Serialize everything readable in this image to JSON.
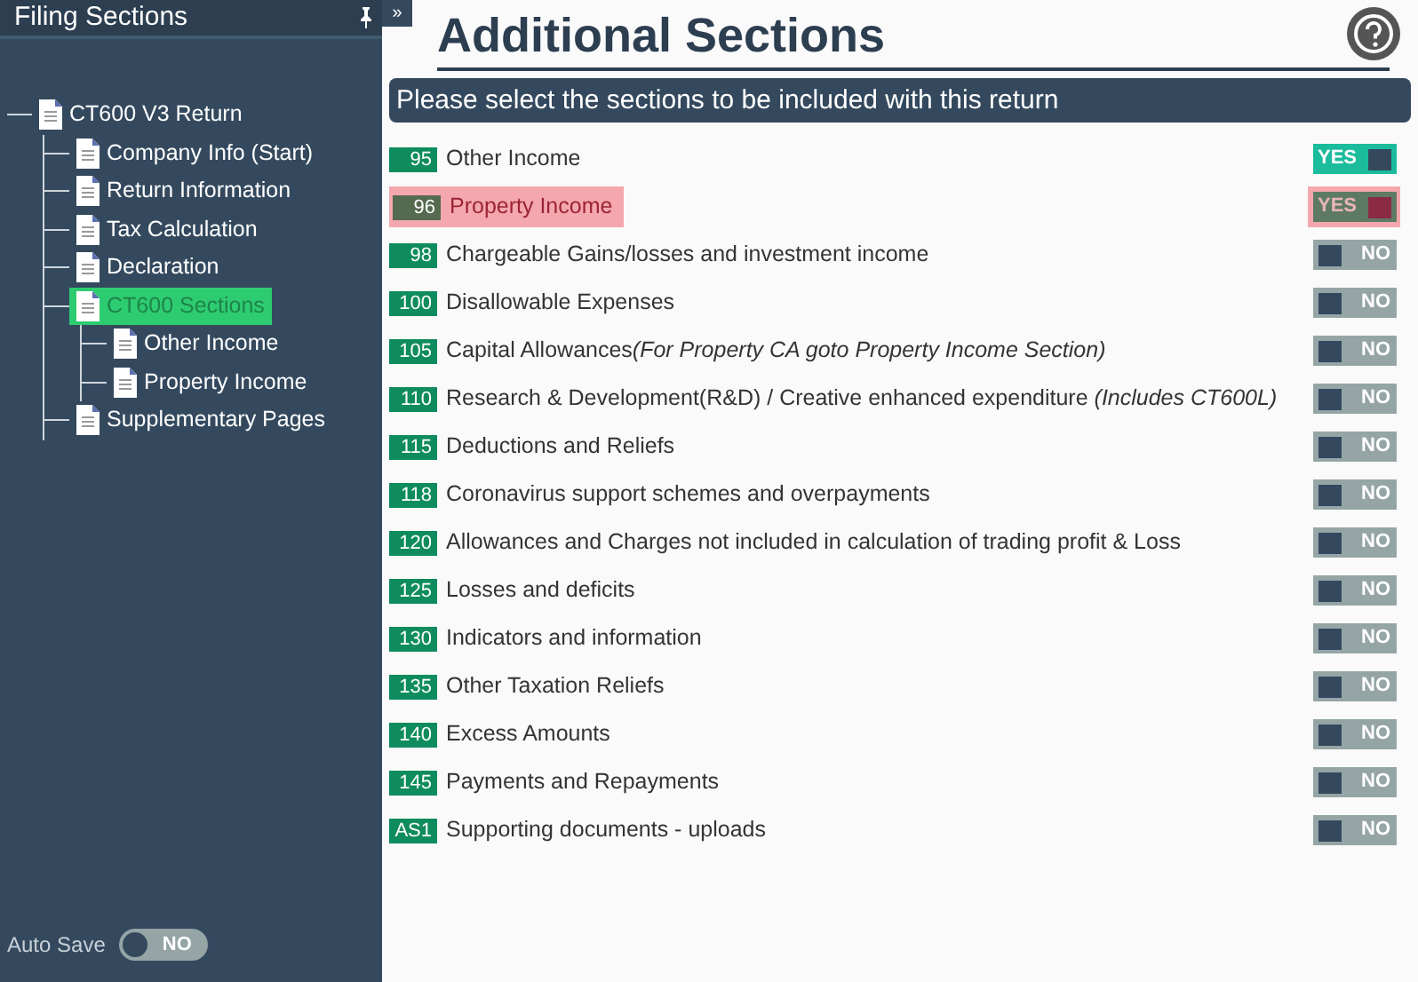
{
  "sidebar": {
    "title": "Filing Sections",
    "collapse_button": "»",
    "tree": [
      {
        "label": "CT600 V3 Return",
        "selected": false,
        "children": [
          {
            "label": "Company Info (Start)",
            "selected": false
          },
          {
            "label": "Return Information",
            "selected": false
          },
          {
            "label": "Tax Calculation",
            "selected": false
          },
          {
            "label": "Declaration",
            "selected": false
          },
          {
            "label": "CT600 Sections",
            "selected": true,
            "children": [
              {
                "label": "Other Income",
                "selected": false
              },
              {
                "label": "Property Income",
                "selected": false
              }
            ]
          },
          {
            "label": "Supplementary Pages",
            "selected": false
          }
        ]
      }
    ],
    "auto_save": {
      "label": "Auto Save",
      "on": false,
      "toggle_text": "NO"
    }
  },
  "main": {
    "title": "Additional Sections",
    "banner": "Please select the sections to be included with this return",
    "sections": [
      {
        "code": "95",
        "label": "Other Income",
        "on": true,
        "highlighted": false,
        "toggle_text": "YES"
      },
      {
        "code": "96",
        "label": "Property Income",
        "on": true,
        "highlighted": true,
        "toggle_text": "YES"
      },
      {
        "code": "98",
        "label": "Chargeable Gains/losses and investment income",
        "on": false,
        "highlighted": false,
        "toggle_text": "NO"
      },
      {
        "code": "100",
        "label": "Disallowable Expenses",
        "on": false,
        "highlighted": false,
        "toggle_text": "NO"
      },
      {
        "code": "105",
        "label": "Capital Allowances",
        "note": "(For Property CA goto Property Income Section)",
        "on": false,
        "highlighted": false,
        "toggle_text": "NO"
      },
      {
        "code": "110",
        "label": "Research & Development(R&D) / Creative enhanced expenditure",
        "note": "(Includes CT600L)",
        "on": false,
        "highlighted": false,
        "toggle_text": "NO"
      },
      {
        "code": "115",
        "label": "Deductions and Reliefs",
        "on": false,
        "highlighted": false,
        "toggle_text": "NO"
      },
      {
        "code": "118",
        "label": "Coronavirus support schemes and overpayments",
        "on": false,
        "highlighted": false,
        "toggle_text": "NO"
      },
      {
        "code": "120",
        "label": "Allowances and Charges not included in calculation of trading profit & Loss",
        "on": false,
        "highlighted": false,
        "toggle_text": "NO"
      },
      {
        "code": "125",
        "label": "Losses and deficits",
        "on": false,
        "highlighted": false,
        "toggle_text": "NO"
      },
      {
        "code": "130",
        "label": "Indicators and information",
        "on": false,
        "highlighted": false,
        "toggle_text": "NO"
      },
      {
        "code": "135",
        "label": "Other Taxation Reliefs",
        "on": false,
        "highlighted": false,
        "toggle_text": "NO"
      },
      {
        "code": "140",
        "label": "Excess Amounts",
        "on": false,
        "highlighted": false,
        "toggle_text": "NO"
      },
      {
        "code": "145",
        "label": "Payments and Repayments",
        "on": false,
        "highlighted": false,
        "toggle_text": "NO"
      },
      {
        "code": "AS1",
        "label": "Supporting documents - uploads",
        "on": false,
        "highlighted": false,
        "toggle_text": "NO"
      }
    ]
  }
}
